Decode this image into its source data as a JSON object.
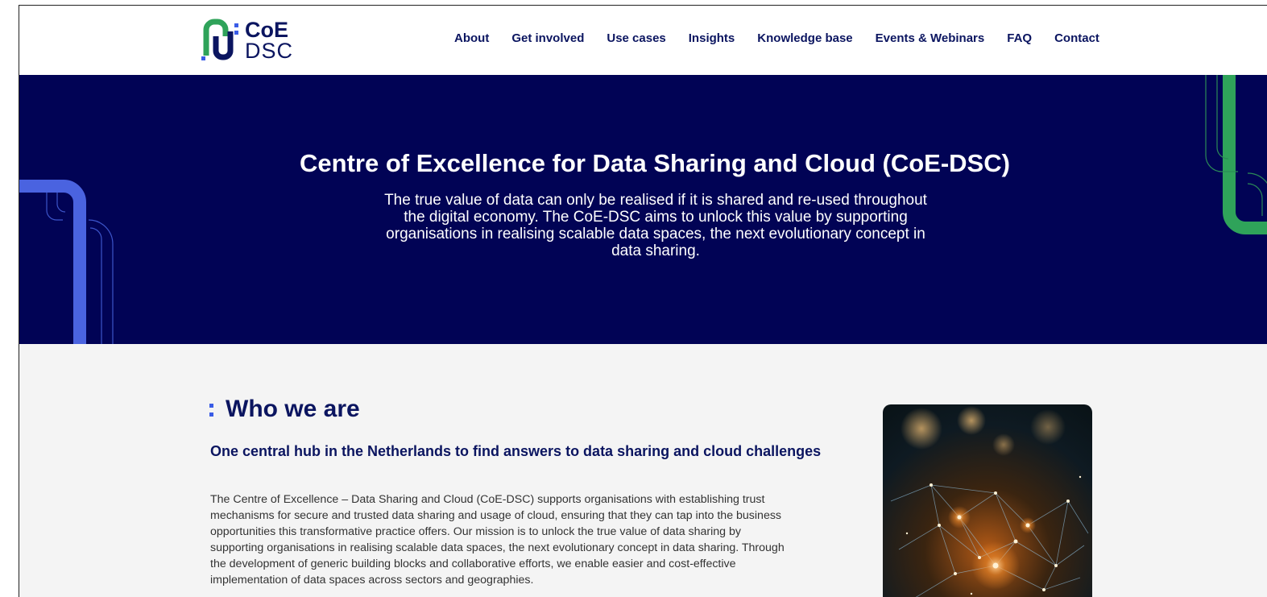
{
  "header": {
    "logo": {
      "line1": "CoE",
      "line2": "DSC"
    },
    "nav": [
      "About",
      "Get involved",
      "Use cases",
      "Insights",
      "Knowledge base",
      "Events & Webinars",
      "FAQ",
      "Contact"
    ]
  },
  "hero": {
    "title": "Centre of Excellence for Data Sharing and Cloud (CoE-DSC)",
    "lines": [
      "The true value of data can only be realised if it is shared and re-used throughout",
      "the digital economy. The CoE-DSC aims to unlock this value by supporting",
      "organisations in realising scalable data spaces, the next evolutionary concept in",
      "data sharing."
    ]
  },
  "who": {
    "heading": "Who we are",
    "subheading": "One central hub in the Netherlands to find answers to data sharing and cloud challenges",
    "body_lines": [
      "The Centre of Excellence – Data Sharing and Cloud (CoE-DSC) supports organisations with establishing trust",
      "mechanisms for secure and trusted data sharing and usage of cloud, ensuring that they can tap into the business",
      "opportunities this transformative practice offers. Our mission is to unlock the true value of data sharing by",
      "supporting organisations in realising scalable data spaces, the next evolutionary concept in data sharing. Through",
      "the development of generic building blocks and collaborative efforts, we enable easier and cost-effective",
      "implementation of data spaces across sectors and geographies."
    ]
  },
  "colors": {
    "navy": "#010355",
    "text_navy": "#0b1560",
    "accent_blue": "#3a5ce6",
    "accent_green": "#2fa35a",
    "section_bg": "#f4f4f4"
  }
}
